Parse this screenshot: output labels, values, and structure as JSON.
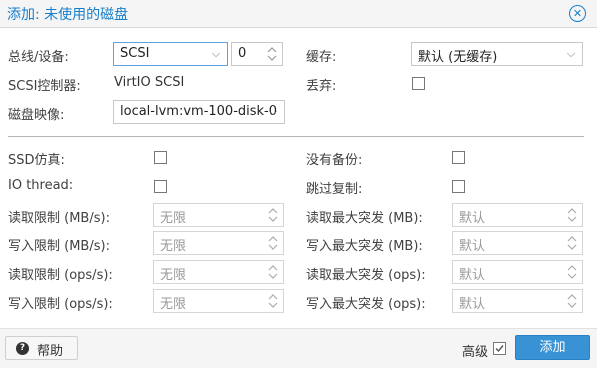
{
  "window": {
    "title": "添加: 未使用的磁盘",
    "close_icon": "close-icon"
  },
  "left": {
    "bus_device": {
      "label": "总线/设备:",
      "bus": "SCSI",
      "device": "0"
    },
    "scsi_controller": {
      "label": "SCSI控制器:",
      "value": "VirtIO SCSI"
    },
    "disk_image": {
      "label": "磁盘映像:",
      "value": "local-lvm:vm-100-disk-0"
    }
  },
  "right": {
    "cache": {
      "label": "缓存:",
      "value": "默认 (无缓存)"
    },
    "discard": {
      "label": "丢弃:",
      "checked": false
    }
  },
  "advanced": {
    "ssd": {
      "label": "SSD仿真:",
      "checked": false
    },
    "iothread": {
      "label": "IO thread:",
      "checked": false
    },
    "no_backup": {
      "label": "没有备份:",
      "checked": false
    },
    "skip_replication": {
      "label": "跳过复制:",
      "checked": false
    },
    "limits": [
      {
        "label": "读取限制 (MB/s):",
        "placeholder": "无限"
      },
      {
        "label": "写入限制 (MB/s):",
        "placeholder": "无限"
      },
      {
        "label": "读取限制 (ops/s):",
        "placeholder": "无限"
      },
      {
        "label": "写入限制 (ops/s):",
        "placeholder": "无限"
      }
    ],
    "bursts": [
      {
        "label": "读取最大突发 (MB):",
        "placeholder": "默认"
      },
      {
        "label": "写入最大突发 (MB):",
        "placeholder": "默认"
      },
      {
        "label": "读取最大突发 (ops):",
        "placeholder": "默认"
      },
      {
        "label": "写入最大突发 (ops):",
        "placeholder": "默认"
      }
    ]
  },
  "footer": {
    "help_label": "帮助",
    "help_icon": "question-circle-icon",
    "advanced_label": "高级",
    "advanced_checked": true,
    "add_label": "添加"
  },
  "colors": {
    "accent": "#157fcc",
    "primary_button": "#3892d4"
  }
}
